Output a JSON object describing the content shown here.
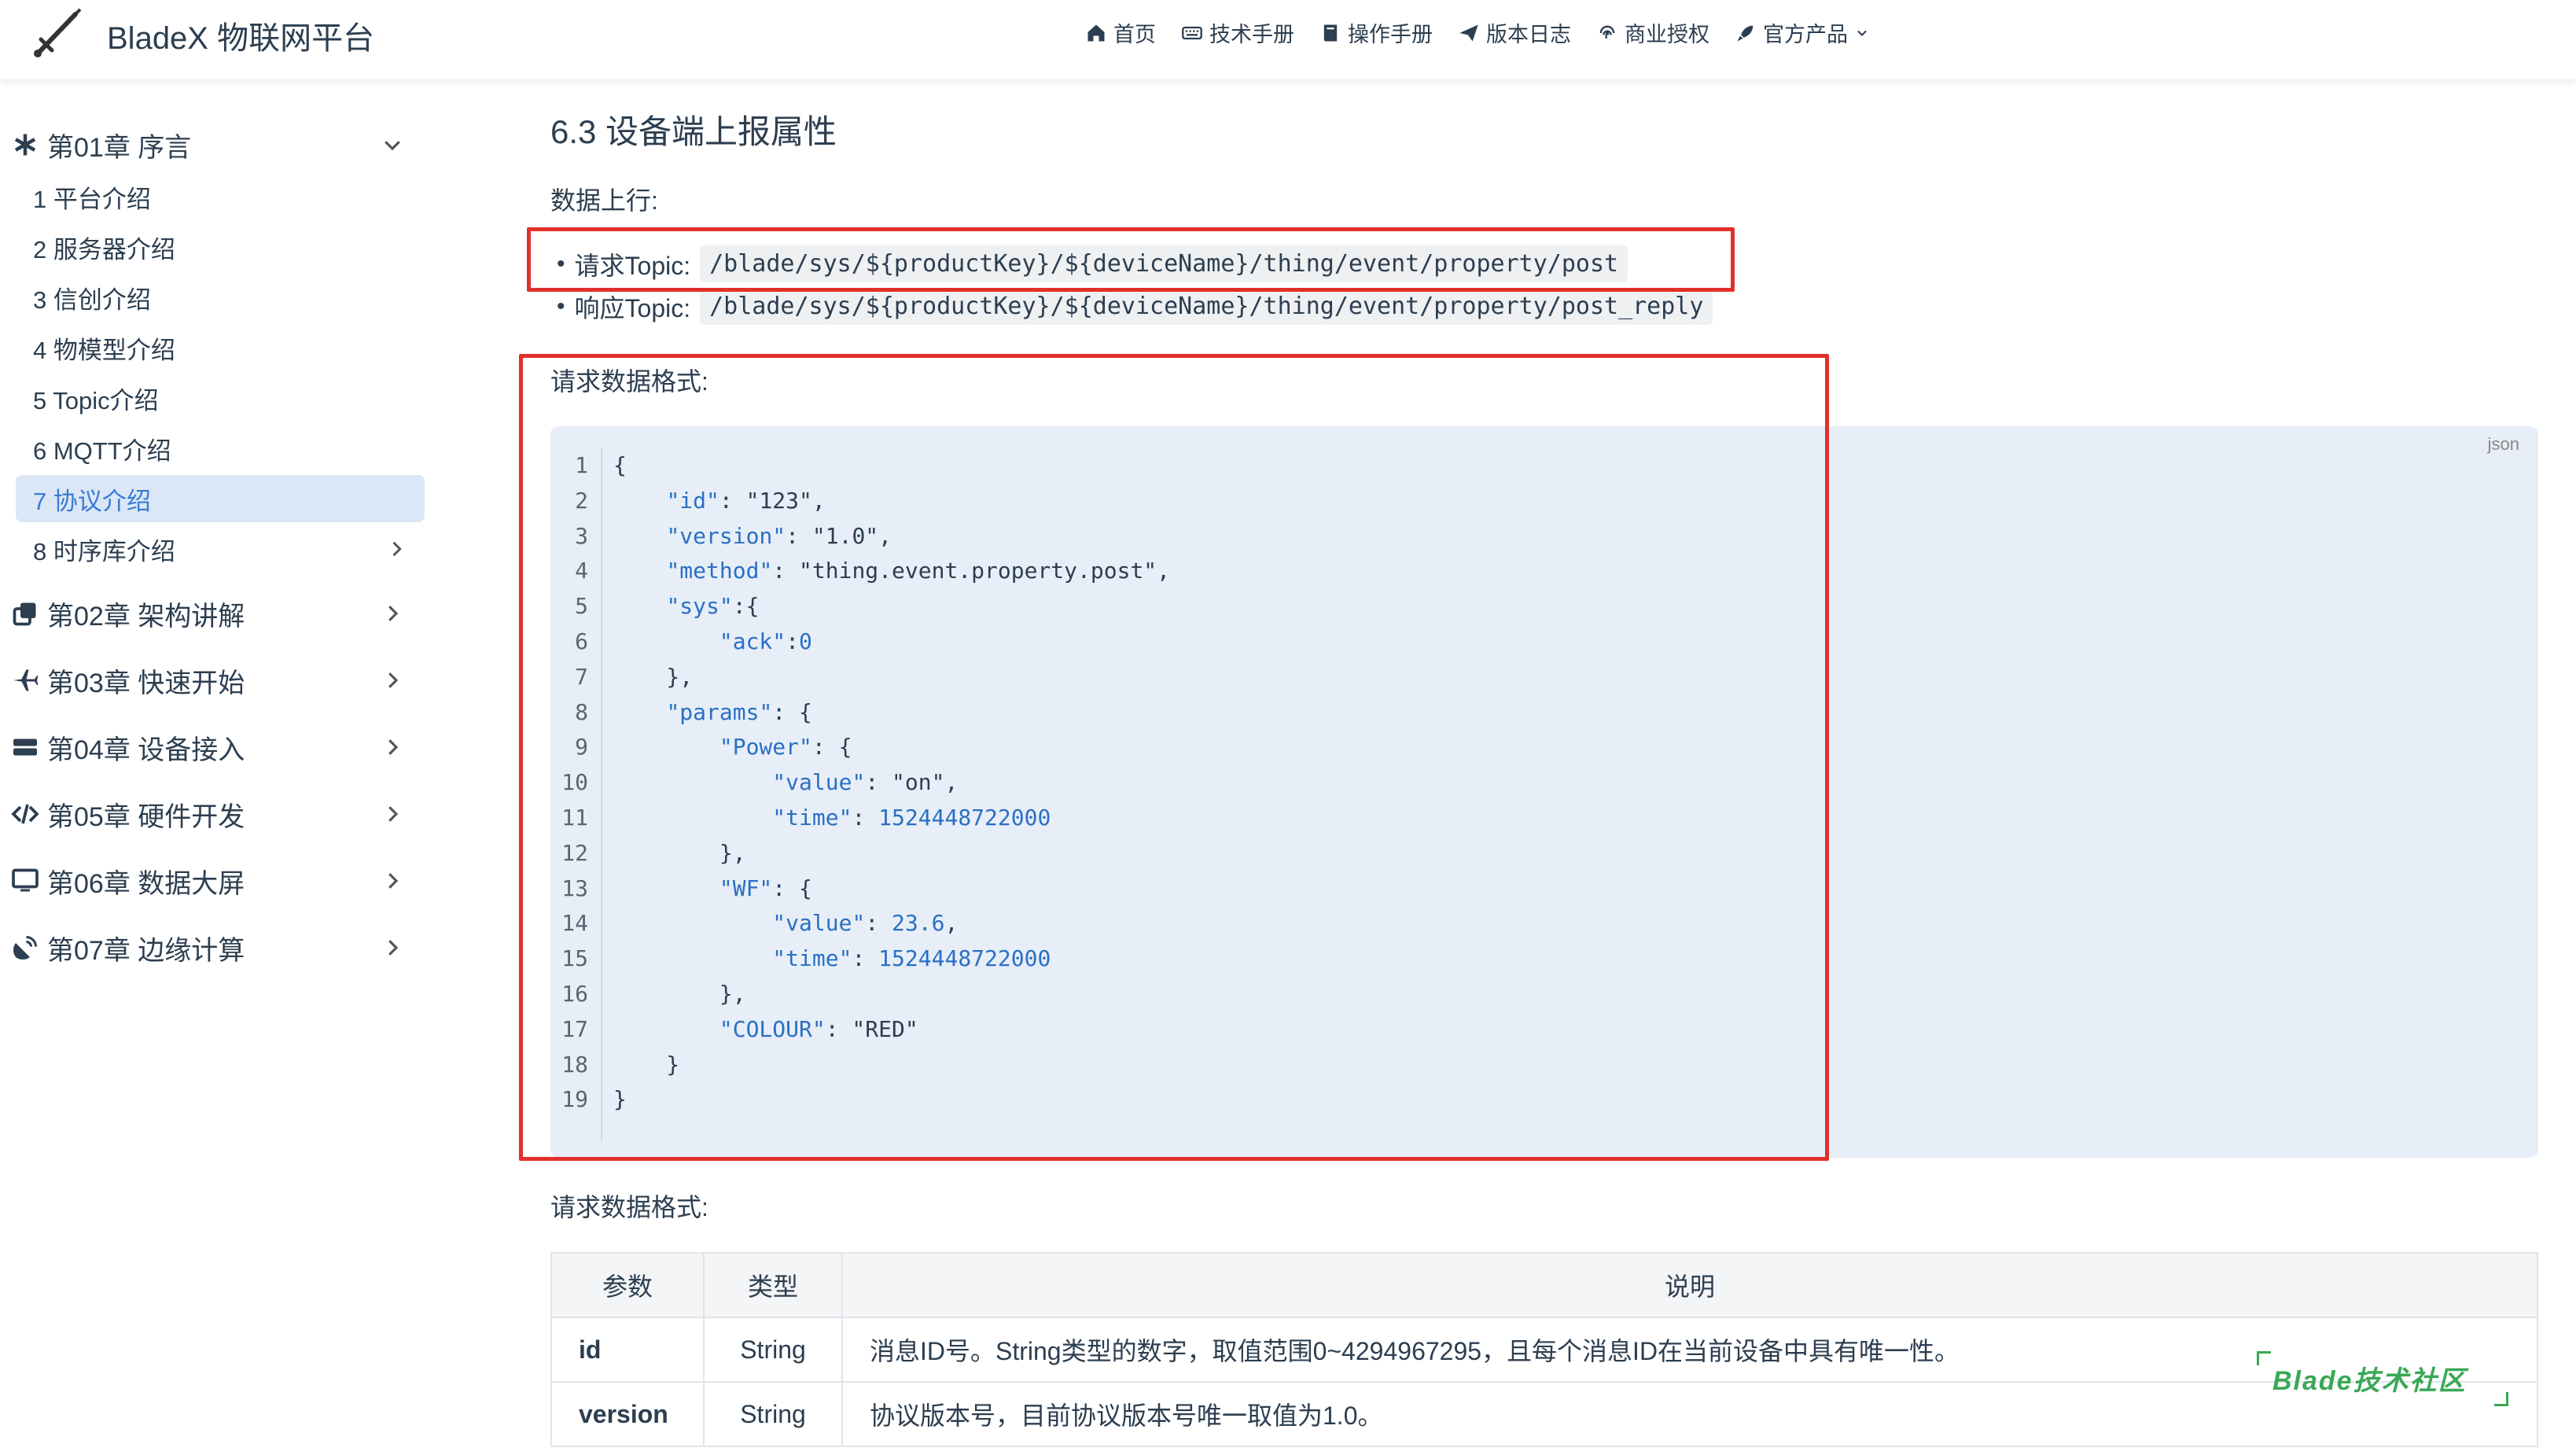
{
  "header": {
    "brand": "BladeX 物联网平台",
    "nav": [
      {
        "label": "首页",
        "icon": "home-icon"
      },
      {
        "label": "技术手册",
        "icon": "keyboard-icon"
      },
      {
        "label": "操作手册",
        "icon": "book-icon"
      },
      {
        "label": "版本日志",
        "icon": "paper-plane-icon"
      },
      {
        "label": "商业授权",
        "icon": "fingerprint-icon"
      },
      {
        "label": "官方产品",
        "icon": "rocket-icon"
      }
    ]
  },
  "sidebar": {
    "chapter1": "第01章 序言",
    "items": [
      "1 平台介绍",
      "2 服务器介绍",
      "3 信创介绍",
      "4 物模型介绍",
      "5 Topic介绍",
      "6 MQTT介绍",
      "7 协议介绍",
      "8 时序库介绍"
    ],
    "groups": [
      "第02章 架构讲解",
      "第03章 快速开始",
      "第04章 设备接入",
      "第05章 硬件开发",
      "第06章 数据大屏",
      "第07章 边缘计算"
    ]
  },
  "content": {
    "heading": "6.3 设备端上报属性",
    "upstream_label": "数据上行:",
    "request_topic_label": "请求Topic:",
    "request_topic": "/blade/sys/${productKey}/${deviceName}/thing/event/property/post",
    "response_topic_label": "响应Topic:",
    "response_topic": "/blade/sys/${productKey}/${deviceName}/thing/event/property/post_reply",
    "request_format_label": "请求数据格式:",
    "code_lang": "json",
    "request_format_label2": "请求数据格式:",
    "table": {
      "headers": [
        "参数",
        "类型",
        "说明"
      ],
      "rows": [
        [
          "id",
          "String",
          "消息ID号。String类型的数字，取值范围0~4294967295，且每个消息ID在当前设备中具有唯一性。"
        ],
        [
          "version",
          "String",
          "协议版本号，目前协议版本号唯一取值为1.0。"
        ]
      ]
    }
  },
  "watermark": "Blade技术社区"
}
